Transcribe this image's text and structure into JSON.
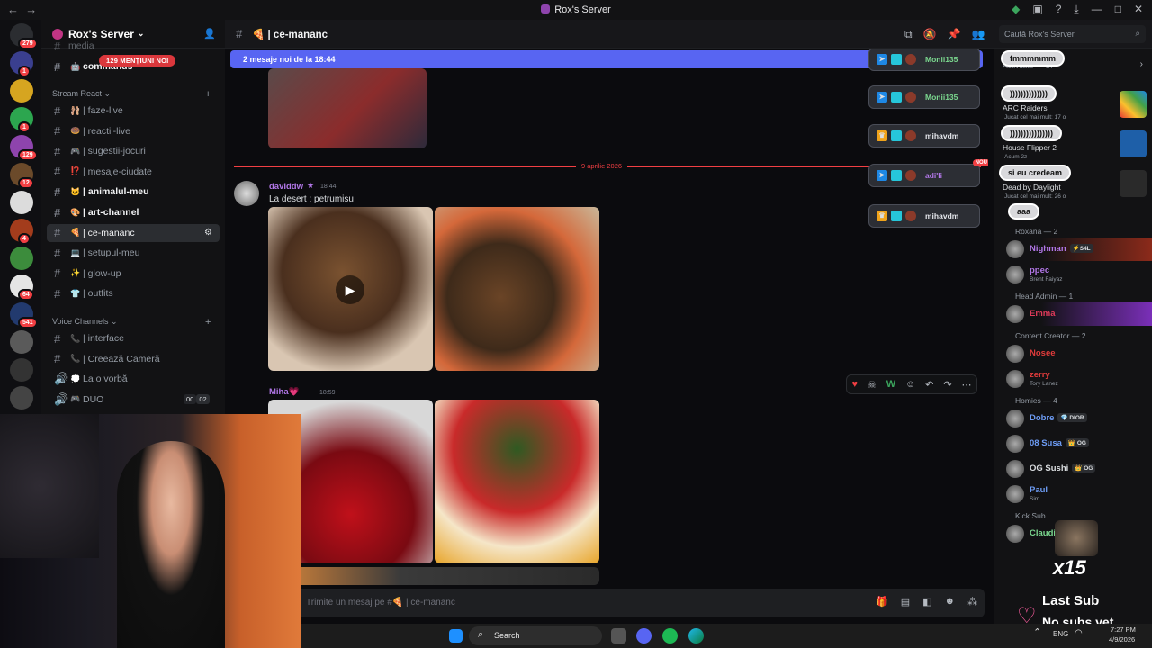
{
  "titlebar": {
    "title": "Rox's Server",
    "back": "←",
    "forward": "→"
  },
  "guilds": [
    {
      "badge": "279"
    },
    {
      "badge": "1"
    },
    {
      "badge": ""
    },
    {
      "badge": "1"
    },
    {
      "badge": "129"
    },
    {
      "badge": "12"
    },
    {
      "badge": ""
    },
    {
      "badge": "4"
    },
    {
      "badge": ""
    },
    {
      "badge": "64"
    },
    {
      "badge": "541"
    },
    {
      "badge": ""
    },
    {
      "badge": ""
    },
    {
      "badge": ""
    }
  ],
  "sidebar": {
    "server_name": "Rox's Server",
    "mentions": "129 MENȚIUNI NOI",
    "partial_top": "media",
    "partial_channel": "commands",
    "category1": "Stream React",
    "channels": [
      {
        "emoji": "🩰",
        "label": "| faze-live"
      },
      {
        "emoji": "🍩",
        "label": "| reactii-live"
      },
      {
        "emoji": "🎮",
        "label": "| sugestii-jocuri"
      },
      {
        "emoji": "⁉️",
        "label": "| mesaje-ciudate"
      },
      {
        "emoji": "🐱",
        "label": "| animalul-meu"
      },
      {
        "emoji": "🎨",
        "label": "| art-channel"
      },
      {
        "emoji": "🍕",
        "label": "| ce-mananc"
      },
      {
        "emoji": "💻",
        "label": "| setupul-meu"
      },
      {
        "emoji": "✨",
        "label": "| glow-up"
      },
      {
        "emoji": "👕",
        "label": "| outfits"
      }
    ],
    "category2": "Voice Channels",
    "voice": [
      {
        "emoji": "📞",
        "label": "| interface"
      },
      {
        "emoji": "📞",
        "label": "| Creează Cameră"
      },
      {
        "emoji": "💭",
        "label": "La o vorbă"
      },
      {
        "emoji": "🎮",
        "label": "DUO"
      }
    ],
    "duo_count_a": "00",
    "duo_count_b": "02"
  },
  "topbar": {
    "channel": "🍕 | ce-mananc",
    "search_placeholder": "Caută Rox's Server"
  },
  "chat": {
    "new_messages": "2 mesaje noi de la 18:44",
    "date_divider": "9 aprilie 2026",
    "msg1": {
      "user": "daviddw",
      "time": "18:44",
      "text": "La desert : petrumisu"
    },
    "msg2": {
      "user": "Miha💗",
      "time": "18:59"
    },
    "composer_placeholder": "Trimite un mesaj pe #🍕 | ce-mananc"
  },
  "notifications": [
    {
      "name": "Monii135",
      "color": "#7bd88f",
      "badge": ""
    },
    {
      "name": "Monii135",
      "color": "#7bd88f",
      "badge": ""
    },
    {
      "name": "mihavdm",
      "color": "#e4e6eb",
      "badge": ""
    },
    {
      "name": "adi'li",
      "color": "#b277e8",
      "badge": "NOU"
    },
    {
      "name": "mihavdm",
      "color": "#e4e6eb",
      "badge": ""
    }
  ],
  "members": {
    "activity_header": "Activitate — 17",
    "activities": [
      {
        "pill": "fmmmmmm",
        "game": "",
        "sub": ""
      },
      {
        "pill": "))))))))))))))",
        "game": "ARC Raiders",
        "sub": "Jucat cel mai mult: 17 o"
      },
      {
        "pill": "))))))))))))))))",
        "game": "House Flipper 2",
        "sub": "Acum 2z"
      },
      {
        "pill": "si eu credeam",
        "game": "Dead by Daylight",
        "sub": "Jucat cel mai mult: 26 o"
      },
      {
        "pill": "aaa",
        "game": "",
        "sub": ""
      }
    ],
    "groups": [
      {
        "title": "Roxana — 2",
        "members": [
          {
            "name": "Nighman",
            "color": "#b277e8",
            "tag": "⚡S4L",
            "status": ""
          },
          {
            "name": "ppec",
            "color": "#b277e8",
            "tag": "",
            "status": "Brent Faiyaz"
          }
        ]
      },
      {
        "title": "Head Admin — 1",
        "members": [
          {
            "name": "Emma",
            "color": "#e03b5a",
            "tag": "",
            "status": ""
          }
        ]
      },
      {
        "title": "Content Creator — 2",
        "members": [
          {
            "name": "Nosee",
            "color": "#e03b3b",
            "tag": "",
            "status": ""
          },
          {
            "name": "zerry",
            "color": "#e03b3b",
            "tag": "",
            "status": "Tory Lanez"
          }
        ]
      },
      {
        "title": "Homies — 4",
        "members": [
          {
            "name": "Dobre",
            "color": "#6d9cf5",
            "tag": "💎 DIOR",
            "status": ""
          },
          {
            "name": "08 Susa",
            "color": "#6d9cf5",
            "tag": "👑 OG",
            "status": ""
          },
          {
            "name": "OG Sushi",
            "color": "#dbdee1",
            "tag": "👑 OG",
            "status": ""
          },
          {
            "name": "Paul",
            "color": "#6d9cf5",
            "tag": "",
            "status": "Sim"
          }
        ]
      },
      {
        "title": "Kick Sub",
        "members": [
          {
            "name": "Claudiu",
            "color": "#7bd88f",
            "tag": "",
            "status": ""
          }
        ]
      }
    ]
  },
  "stream_overlay": {
    "multiplier": "x15",
    "last_sub_label": "Last Sub",
    "last_sub_value": "No subs yet"
  },
  "taskbar": {
    "search": "Search",
    "lang": "ENG",
    "time": "7:27 PM",
    "date": "4/9/2026"
  },
  "colors": {
    "accent": "#5865f2",
    "danger": "#f23f43",
    "bg": "#0b0b0e"
  }
}
